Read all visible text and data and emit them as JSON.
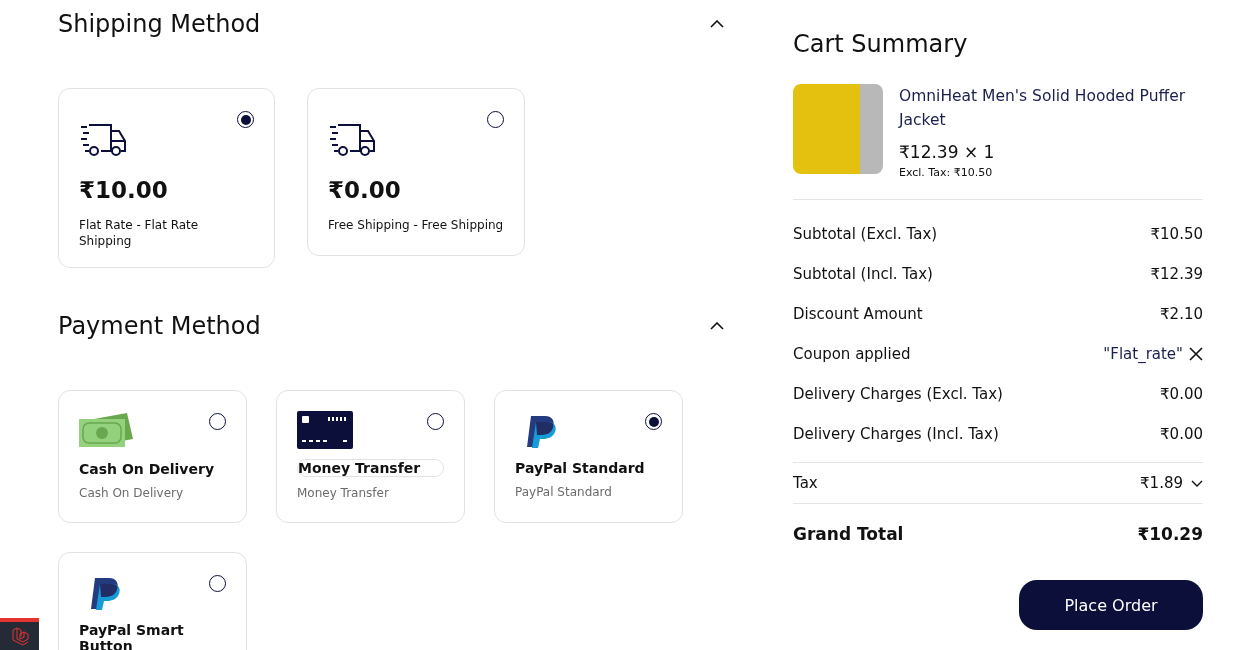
{
  "shipping": {
    "title": "Shipping Method",
    "expanded": true,
    "methods": [
      {
        "price": "₹10.00",
        "label": "Flat Rate - Flat Rate Shipping",
        "selected": true
      },
      {
        "price": "₹0.00",
        "label": "Free Shipping - Free Shipping",
        "selected": false
      }
    ]
  },
  "payment": {
    "title": "Payment Method",
    "expanded": true,
    "methods": [
      {
        "kind": "cash",
        "name": "Cash On Delivery",
        "description": "Cash On Delivery",
        "selected": false
      },
      {
        "kind": "card",
        "name": "Money Transfer",
        "description": "Money Transfer",
        "selected": false
      },
      {
        "kind": "paypal",
        "name": "PayPal Standard",
        "description": "PayPal Standard",
        "selected": true
      },
      {
        "kind": "paypal",
        "name": "PayPal Smart Button",
        "selected": false
      }
    ]
  },
  "cart": {
    "title": "Cart Summary",
    "item": {
      "name": "OmniHeat Men's Solid Hooded Puffer Jacket",
      "price": "₹12.39 × 1",
      "excl_tax": "Excl. Tax: ₹10.50"
    },
    "lines": [
      {
        "kind": "plain",
        "label": "Subtotal (Excl. Tax)",
        "value": "₹10.50"
      },
      {
        "kind": "plain",
        "label": "Subtotal (Incl. Tax)",
        "value": "₹12.39"
      },
      {
        "kind": "plain",
        "label": "Discount Amount",
        "value": "₹2.10"
      },
      {
        "kind": "coupon",
        "label": "Coupon applied",
        "value": "\"Flat_rate\""
      },
      {
        "kind": "plain",
        "label": "Delivery Charges (Excl. Tax)",
        "value": "₹0.00"
      },
      {
        "kind": "plain",
        "label": "Delivery Charges (Incl. Tax)",
        "value": "₹0.00"
      },
      {
        "kind": "tax",
        "label": "Tax",
        "value": "₹1.89"
      },
      {
        "kind": "total",
        "label": "Grand Total",
        "value": "₹10.29"
      }
    ],
    "button": "Place Order"
  }
}
